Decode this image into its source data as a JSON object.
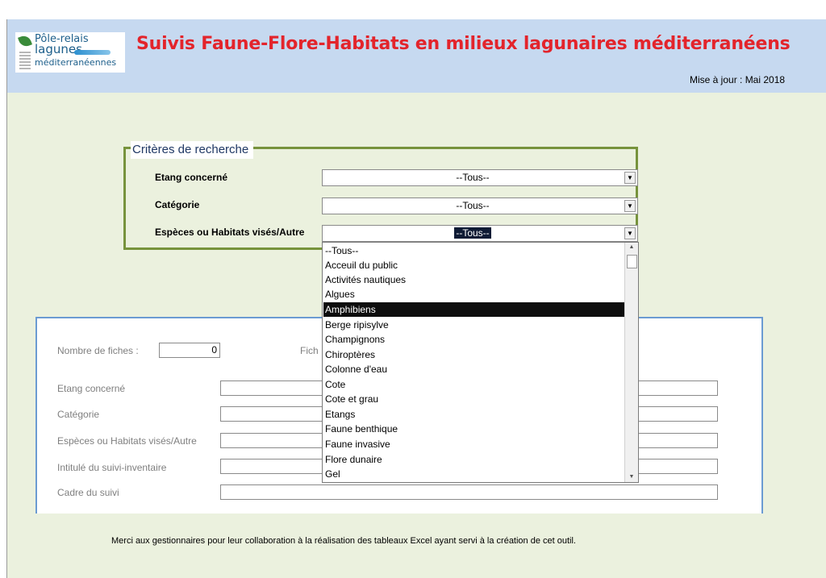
{
  "header": {
    "logo": {
      "line1": "Pôle-relais",
      "line2": "lagunes",
      "line3": "méditerranéennes"
    },
    "title": "Suivis Faune-Flore-Habitats en milieux lagunaires méditerranéens",
    "update": "Mise à jour : Mai 2018"
  },
  "criteria": {
    "title": "Critères de recherche",
    "fields": [
      {
        "label": "Etang concerné",
        "value": "--Tous--"
      },
      {
        "label": "Catégorie",
        "value": "--Tous--"
      },
      {
        "label": "Espèces ou Habitats visés/Autre",
        "value": "--Tous--"
      }
    ]
  },
  "dropdown": {
    "items": [
      "--Tous--",
      "Acceuil du public",
      "Activités nautiques",
      "Algues",
      "Amphibiens",
      "Berge ripisylve",
      "Champignons",
      "Chiroptères",
      "Colonne d'eau",
      "Cote",
      "Cote et grau",
      "Etangs",
      "Faune benthique",
      "Faune invasive",
      "Flore dunaire",
      "Gel"
    ],
    "highlighted": "Amphibiens"
  },
  "results": {
    "count_label": "Nombre de fiches :",
    "count_value": "0",
    "fiche_label_partial": "Fich",
    "rows": [
      "Etang concerné",
      "Catégorie",
      "Espèces ou Habitats visés/Autre",
      "Intitulé du suivi-inventaire",
      "Cadre du suivi"
    ]
  },
  "footer": "Merci aux gestionnaires pour leur collaboration à la réalisation des tableaux Excel ayant servi à la création de cet outil.",
  "colors": {
    "header_bg": "#c6d9f0",
    "main_bg": "#ebf1de",
    "title_red": "#e3242b",
    "criteria_border": "#77933c",
    "results_border": "#6b9bd2",
    "highlight": "#0d0d0d"
  }
}
